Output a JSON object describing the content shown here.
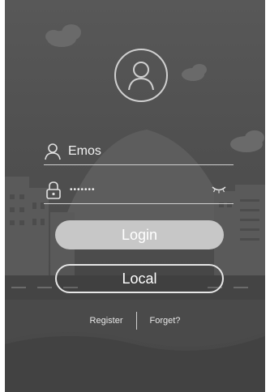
{
  "login": {
    "username_value": "Emos",
    "password_mask": "•••••••",
    "login_label": "Login",
    "local_label": "Local",
    "register_label": "Register",
    "forget_label": "Forget?"
  },
  "icons": {
    "avatar": "user-avatar-icon",
    "user_field": "user-icon",
    "password_field": "lock-icon",
    "show_password": "eye-closed-icon"
  },
  "colors": {
    "background": "#4f4f4f",
    "primary_button": "#c7c7c7",
    "text": "#ffffff"
  }
}
